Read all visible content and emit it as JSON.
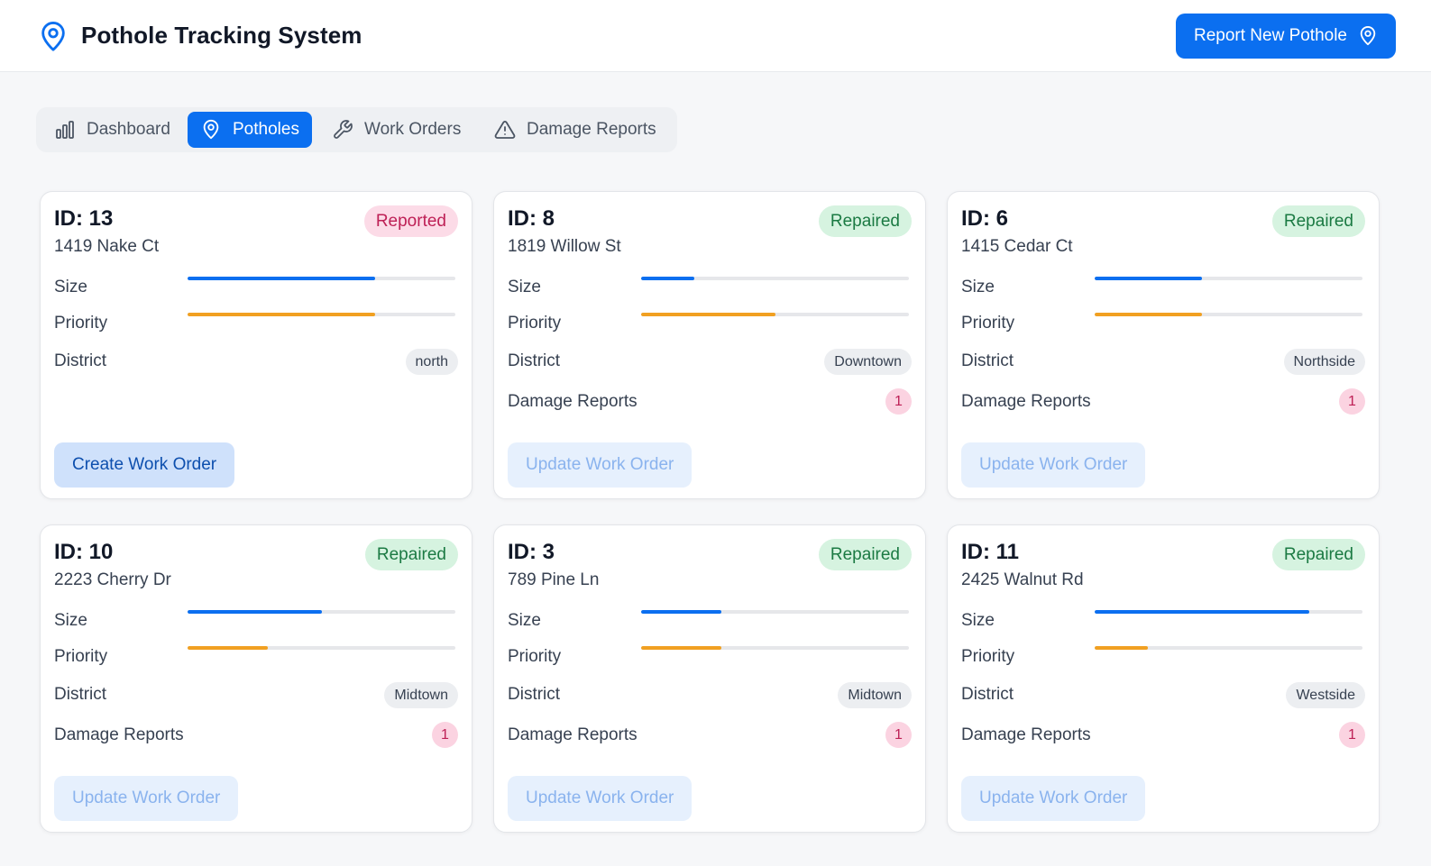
{
  "header": {
    "title": "Pothole Tracking System",
    "logo_icon": "map-pin-icon",
    "report_button_label": "Report New Pothole",
    "report_button_icon": "map-pin-icon"
  },
  "tabs": [
    {
      "label": "Dashboard",
      "icon": "bar-chart-icon",
      "active": false
    },
    {
      "label": "Potholes",
      "icon": "map-pin-icon",
      "active": true
    },
    {
      "label": "Work Orders",
      "icon": "wrench-icon",
      "active": false
    },
    {
      "label": "Damage Reports",
      "icon": "alert-triangle-icon",
      "active": false
    }
  ],
  "colors": {
    "primary": "#0b6ff0",
    "size_bar": "#0b6ff0",
    "priority_bar": "#f1a021",
    "reported_badge_bg": "#fcdbe7",
    "repaired_badge_bg": "#d6f3e0"
  },
  "field_labels": {
    "size": "Size",
    "priority": "Priority",
    "district": "District",
    "damage_reports": "Damage Reports"
  },
  "potholes": [
    {
      "id": "ID: 13",
      "address": "1419 Nake Ct",
      "status": "Reported",
      "size": 0.7,
      "priority": 0.7,
      "district": "north",
      "damage_reports": null,
      "action": "Create Work Order"
    },
    {
      "id": "ID: 8",
      "address": "1819 Willow St",
      "status": "Repaired",
      "size": 0.2,
      "priority": 0.5,
      "district": "Downtown",
      "damage_reports": "1",
      "action": "Update Work Order"
    },
    {
      "id": "ID: 6",
      "address": "1415 Cedar Ct",
      "status": "Repaired",
      "size": 0.4,
      "priority": 0.4,
      "district": "Northside",
      "damage_reports": "1",
      "action": "Update Work Order"
    },
    {
      "id": "ID: 10",
      "address": "2223 Cherry Dr",
      "status": "Repaired",
      "size": 0.5,
      "priority": 0.3,
      "district": "Midtown",
      "damage_reports": "1",
      "action": "Update Work Order"
    },
    {
      "id": "ID: 3",
      "address": "789 Pine Ln",
      "status": "Repaired",
      "size": 0.3,
      "priority": 0.3,
      "district": "Midtown",
      "damage_reports": "1",
      "action": "Update Work Order"
    },
    {
      "id": "ID: 11",
      "address": "2425 Walnut Rd",
      "status": "Repaired",
      "size": 0.8,
      "priority": 0.2,
      "district": "Westside",
      "damage_reports": "1",
      "action": "Update Work Order"
    }
  ]
}
